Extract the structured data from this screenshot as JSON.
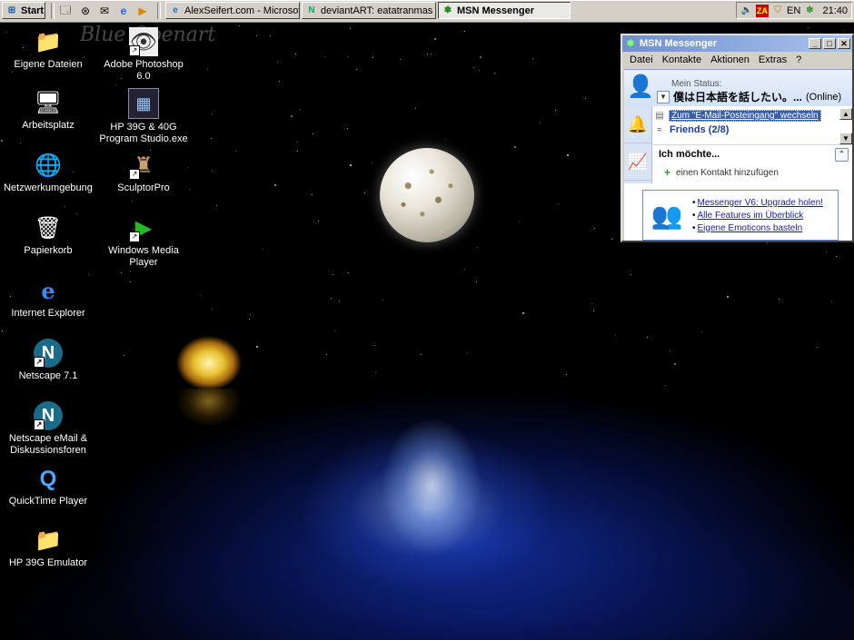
{
  "taskbar": {
    "start_label": "Start",
    "quick_launch": [
      "show-desktop-icon",
      "outlook-express-icon",
      "mail-icon",
      "ie-icon",
      "media-player-icon"
    ],
    "tasks": [
      {
        "label": "AlexSeifert.com - Microsoft...",
        "icon": "ie-icon"
      },
      {
        "label": "deviantART: eatatranmas -...",
        "icon": "netscape-icon"
      },
      {
        "label": "MSN Messenger",
        "icon": "msn-icon",
        "active": true
      }
    ],
    "tray": {
      "lang": "EN",
      "clock": "21:40"
    }
  },
  "desktop": {
    "watermark": "Blue Openart",
    "icons_col1": [
      {
        "label": "Eigene Dateien",
        "icon": "folder-icon"
      },
      {
        "label": "Arbeitsplatz",
        "icon": "computer-icon"
      },
      {
        "label": "Netzwerkumgebung",
        "icon": "network-icon"
      },
      {
        "label": "Papierkorb",
        "icon": "recycle-bin-icon"
      },
      {
        "label": "Internet Explorer",
        "icon": "ie-icon"
      },
      {
        "label": "Netscape 7.1",
        "icon": "netscape-icon"
      },
      {
        "label": "Netscape eMail & Diskussionsforen",
        "icon": "netscape-mail-icon"
      },
      {
        "label": "QuickTime Player",
        "icon": "quicktime-icon"
      },
      {
        "label": "HP 39G Emulator",
        "icon": "folder-icon"
      }
    ],
    "icons_col2": [
      {
        "label": "Adobe Photoshop 6.0",
        "icon": "photoshop-icon"
      },
      {
        "label": "HP 39G & 40G Program Studio.exe",
        "icon": "calculator-icon"
      },
      {
        "label": "SculptorPro",
        "icon": "sculptor-icon"
      },
      {
        "label": "Windows Media Player",
        "icon": "media-player-icon"
      }
    ]
  },
  "msn": {
    "title": "MSN Messenger",
    "menu": [
      "Datei",
      "Kontakte",
      "Aktionen",
      "Extras",
      "?"
    ],
    "status_label": "Mein Status:",
    "status_name": "僕は日本語を話したい。...",
    "status_state": "(Online)",
    "inbox_link": "Zum \"E-Mail-Posteingang\" wechseln",
    "friends_label": "Friends (2/8)",
    "want_header": "Ich möchte...",
    "add_contact": "einen Kontakt hinzufügen",
    "ad_links": [
      "Messenger V6: Upgrade holen!",
      "Alle Features im Überblick",
      "Eigene Emoticons basteln"
    ]
  }
}
